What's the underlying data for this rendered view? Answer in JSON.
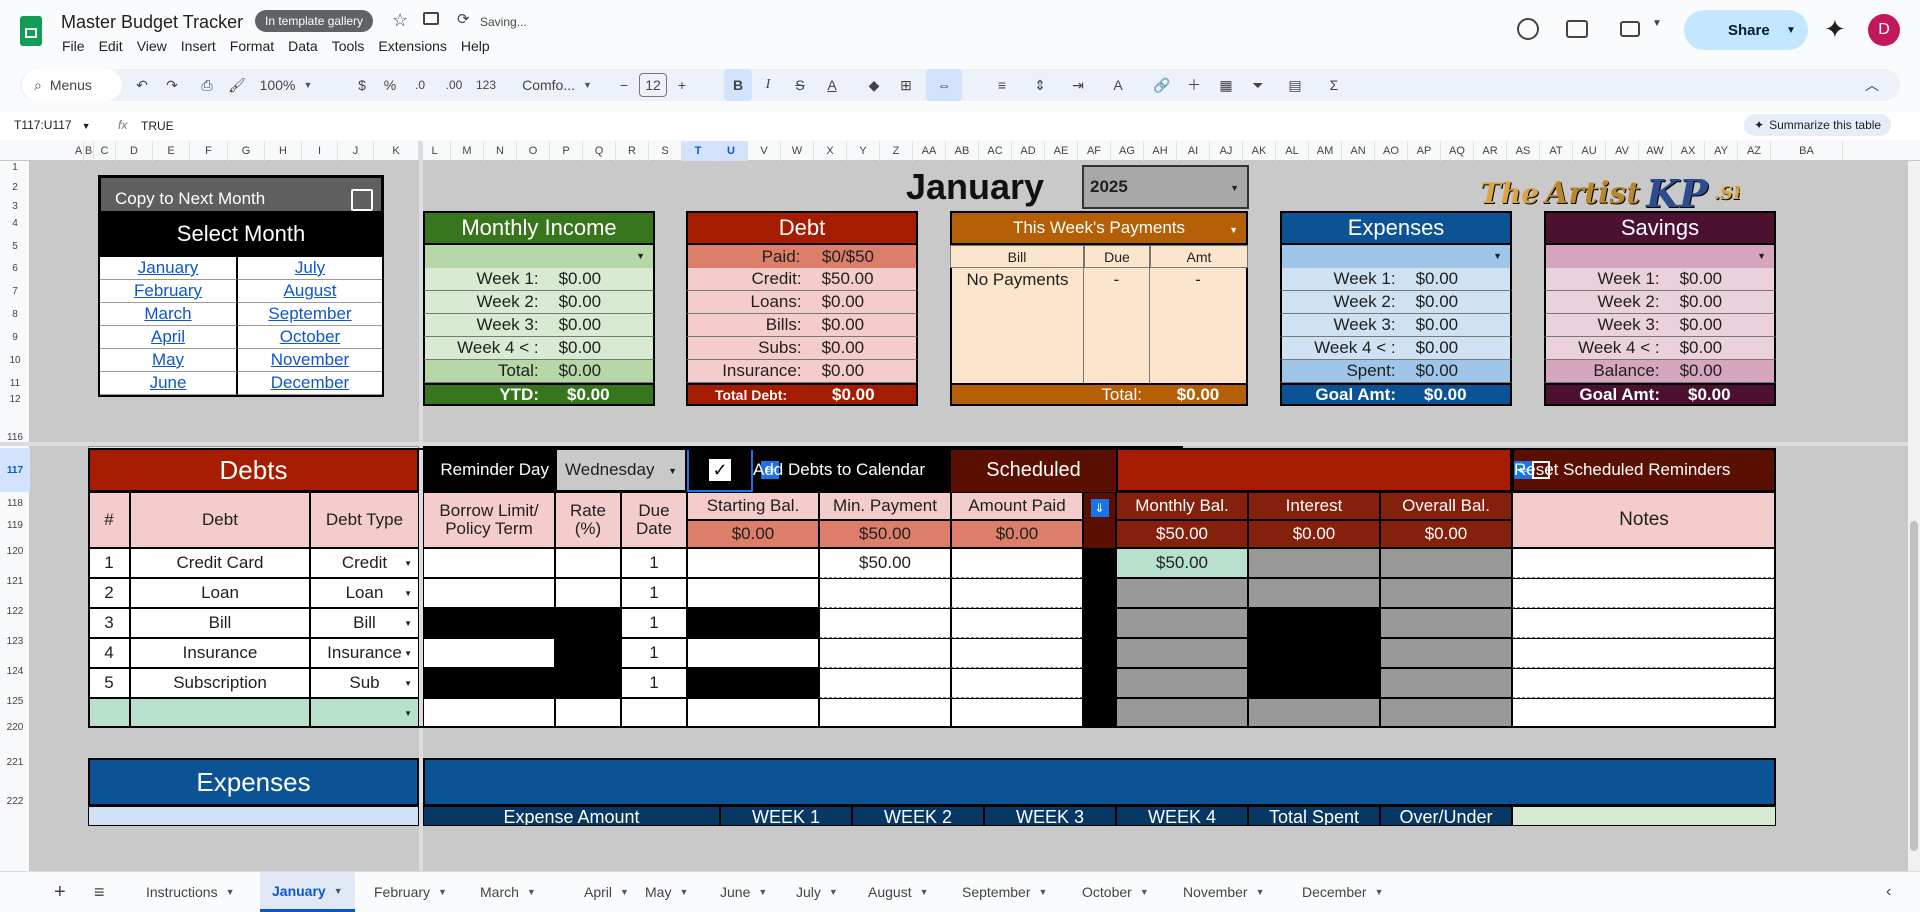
{
  "app": {
    "title": "Master Budget Tracker",
    "gallery_badge": "In template gallery",
    "saving": "Saving...",
    "share": "Share",
    "avatar": "D",
    "menus": [
      "File",
      "Edit",
      "View",
      "Insert",
      "Format",
      "Data",
      "Tools",
      "Extensions",
      "Help"
    ]
  },
  "toolbar": {
    "search": "Menus",
    "zoom": "100%",
    "currency": "$",
    "percent": "%",
    "dec_minus": ".0",
    "dec_plus": ".00",
    "number_fmt": "123",
    "font": "Comfo...",
    "font_size": "12",
    "summarize": "Summarize this table"
  },
  "formula": {
    "cell_ref": "T117:U117",
    "fx": "fx",
    "value": "TRUE"
  },
  "columns": [
    "A",
    "B",
    "C",
    "D",
    "E",
    "F",
    "G",
    "H",
    "I",
    "J",
    "K",
    "L",
    "M",
    "N",
    "O",
    "P",
    "Q",
    "R",
    "S",
    "T",
    "U",
    "V",
    "W",
    "X",
    "Y",
    "Z",
    "AA",
    "AB",
    "AC",
    "AD",
    "AE",
    "AF",
    "AG",
    "AH",
    "AI",
    "AJ",
    "AK",
    "AL",
    "AM",
    "AN",
    "AO",
    "AP",
    "AQ",
    "AR",
    "AS",
    "AT",
    "AU",
    "AV",
    "AW",
    "AX",
    "AY",
    "AZ",
    "BA"
  ],
  "rows": [
    "1",
    "2",
    "3",
    "4",
    "5",
    "6",
    "7",
    "8",
    "9",
    "10",
    "11",
    "12",
    "",
    "116",
    "117",
    "118",
    "119",
    "120",
    "121",
    "122",
    "123",
    "124",
    "125",
    "220",
    "221",
    "222"
  ],
  "header": {
    "copy_btn": "Copy to Next Month",
    "month": "January",
    "year": "2025",
    "brand1": "The",
    "brand2": "Artist",
    "brand3": "KP",
    "brand4": ".SHOP"
  },
  "select_month": {
    "title": "Select Month",
    "left": [
      "January",
      "February",
      "March",
      "April",
      "May",
      "June"
    ],
    "right": [
      "July",
      "August",
      "September",
      "October",
      "November",
      "December"
    ]
  },
  "income": {
    "title": "Monthly Income",
    "rows": [
      [
        "Week 1:",
        "$0.00"
      ],
      [
        "Week 2:",
        "$0.00"
      ],
      [
        "Week 3:",
        "$0.00"
      ],
      [
        "Week 4 < :",
        "$0.00"
      ],
      [
        "Total:",
        "$0.00"
      ]
    ],
    "ytd_label": "YTD:",
    "ytd": "$0.00"
  },
  "debt": {
    "title": "Debt",
    "paid_label": "Paid:",
    "paid": "$0/$50",
    "rows": [
      [
        "Credit:",
        "$50.00"
      ],
      [
        "Loans:",
        "$0.00"
      ],
      [
        "Bills:",
        "$0.00"
      ],
      [
        "Subs:",
        "$0.00"
      ],
      [
        "Insurance:",
        "$0.00"
      ]
    ],
    "total_label": "Total Debt:",
    "total": "$0.00"
  },
  "week_payments": {
    "title": "This Week's Payments",
    "col_bill": "Bill",
    "col_due": "Due",
    "col_amt": "Amt",
    "first_bill": "No Payments",
    "first_due": "-",
    "first_amt": "-",
    "total_label": "Total:",
    "total": "$0.00"
  },
  "expenses_box": {
    "title": "Expenses",
    "rows": [
      [
        "Week 1:",
        "$0.00"
      ],
      [
        "Week 2:",
        "$0.00"
      ],
      [
        "Week 3:",
        "$0.00"
      ],
      [
        "Week 4 < :",
        "$0.00"
      ],
      [
        "Spent:",
        "$0.00"
      ]
    ],
    "goal_label": "Goal Amt:",
    "goal": "$0.00"
  },
  "savings": {
    "title": "Savings",
    "rows": [
      [
        "Week 1:",
        "$0.00"
      ],
      [
        "Week 2:",
        "$0.00"
      ],
      [
        "Week 3:",
        "$0.00"
      ],
      [
        "Week 4 < :",
        "$0.00"
      ],
      [
        "Balance:",
        "$0.00"
      ]
    ],
    "goal_label": "Goal Amt:",
    "goal": "$0.00"
  },
  "debts": {
    "title": "Debts",
    "reminder_label": "Reminder Day",
    "reminder_day": "Wednesday",
    "add_calendar": "Add Debts to Calendar",
    "scheduled": "Scheduled",
    "reset": "Reset Scheduled Reminders",
    "cols": {
      "num": "#",
      "debt": "Debt",
      "type": "Debt Type",
      "limit": "Borrow Limit/ Policy Term",
      "rate": "Rate (%)",
      "due": "Due Date",
      "start": "Starting Bal.",
      "minpay": "Min. Payment",
      "paid": "Amount Paid",
      "monthly": "Monthly Bal.",
      "interest": "Interest",
      "overall": "Overall Bal.",
      "notes": "Notes"
    },
    "totals": {
      "start": "$0.00",
      "minpay": "$50.00",
      "paid": "$0.00",
      "monthly": "$50.00",
      "interest": "$0.00",
      "overall": "$0.00"
    },
    "rows": [
      {
        "n": "1",
        "name": "Credit Card",
        "type": "Credit",
        "due": "1",
        "minpay": "$50.00",
        "monthly": "$50.00"
      },
      {
        "n": "2",
        "name": "Loan",
        "type": "Loan",
        "due": "1",
        "minpay": "",
        "monthly": ""
      },
      {
        "n": "3",
        "name": "Bill",
        "type": "Bill",
        "due": "1",
        "minpay": "",
        "monthly": ""
      },
      {
        "n": "4",
        "name": "Insurance",
        "type": "Insurance",
        "due": "1",
        "minpay": "",
        "monthly": ""
      },
      {
        "n": "5",
        "name": "Subscription",
        "type": "Sub",
        "due": "1",
        "minpay": "",
        "monthly": ""
      }
    ]
  },
  "expenses_section": {
    "title": "Expenses",
    "c1": "Expense Amount",
    "c2": "WEEK 1",
    "c3": "WEEK 2",
    "c4": "WEEK 3",
    "c5": "WEEK 4",
    "c6": "Total Spent",
    "c7": "Over/Under"
  },
  "tabs": [
    "Instructions",
    "January",
    "February",
    "March",
    "April",
    "May",
    "June",
    "July",
    "August",
    "September",
    "October",
    "November",
    "December"
  ],
  "colors": {
    "income": "#38761d",
    "debt": "#a61c00",
    "payments": "#b45f06",
    "expenses": "#0b5394",
    "savings": "#4c1130"
  }
}
